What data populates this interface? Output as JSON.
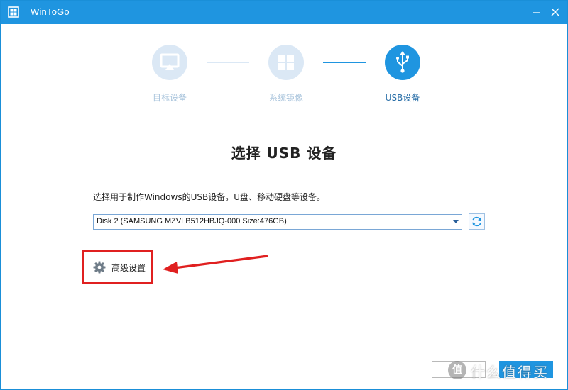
{
  "window": {
    "title": "WinToGo",
    "accent_color": "#1f95e0",
    "icons": {
      "app": "windows-grid-icon",
      "minimize": "minimize-icon",
      "close": "close-icon"
    }
  },
  "steps": [
    {
      "label": "目标设备",
      "icon": "monitor-icon",
      "state": "done"
    },
    {
      "label": "系统镜像",
      "icon": "windows-logo-icon",
      "state": "done"
    },
    {
      "label": "USB设备",
      "icon": "usb-icon",
      "state": "active"
    }
  ],
  "main": {
    "heading": "选择 USB 设备",
    "description": "选择用于制作Windows的USB设备，U盘、移动硬盘等设备。",
    "device_select": {
      "selected": "Disk 2 (SAMSUNG MZVLB512HBJQ-000 Size:476GB)"
    },
    "refresh_icon": "refresh-icon",
    "advanced_settings": {
      "label": "高级设置",
      "icon": "gear-icon"
    },
    "annotation_color": "#e02020"
  },
  "footer": {
    "watermark": {
      "badge": "值",
      "text": "什么值得买"
    }
  }
}
